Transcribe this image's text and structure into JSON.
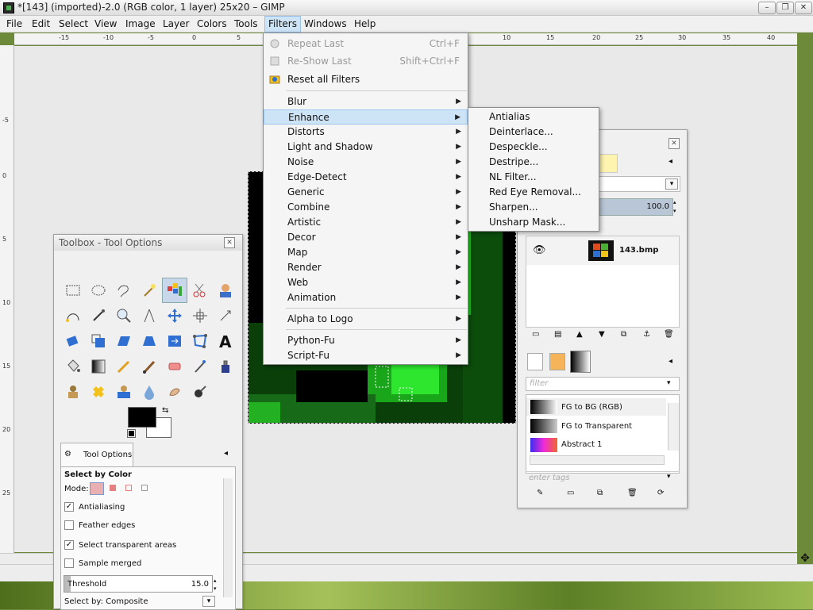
{
  "window": {
    "title": "*[143] (imported)-2.0 (RGB color, 1 layer) 25x20 – GIMP",
    "controls": [
      "–",
      "❐",
      "✕"
    ]
  },
  "menubar": [
    "File",
    "Edit",
    "Select",
    "View",
    "Image",
    "Layer",
    "Colors",
    "Tools",
    "Filters",
    "Windows",
    "Help"
  ],
  "ruler": {
    "h_labels": [
      "-15",
      "-10",
      "-5",
      "0",
      "5",
      "10",
      "15",
      "20",
      "25",
      "30",
      "35",
      "40"
    ],
    "v_labels": [
      "-5",
      "0",
      "5",
      "10",
      "15",
      "20",
      "25"
    ]
  },
  "filters_menu": {
    "top": [
      {
        "label": "Repeat Last",
        "accel": "Ctrl+F",
        "disabled": true,
        "icon": "repeat-icon"
      },
      {
        "label": "Re-Show Last",
        "accel": "Shift+Ctrl+F",
        "disabled": true,
        "icon": "reshow-icon"
      },
      {
        "label": "Reset all Filters",
        "accel": "",
        "disabled": false,
        "icon": "reset-icon"
      }
    ],
    "groups": [
      "Blur",
      "Enhance",
      "Distorts",
      "Light and Shadow",
      "Noise",
      "Edge-Detect",
      "Generic",
      "Combine",
      "Artistic",
      "Decor",
      "Map",
      "Render",
      "Web",
      "Animation"
    ],
    "alpha": "Alpha to Logo",
    "scripting": [
      "Python-Fu",
      "Script-Fu"
    ]
  },
  "enhance_menu": [
    "Antialias",
    "Deinterlace...",
    "Despeckle...",
    "Destripe...",
    "NL Filter...",
    "Red Eye Removal...",
    "Sharpen...",
    "Unsharp Mask..."
  ],
  "toolbox": {
    "title": "Toolbox - Tool Options",
    "tab": "Tool Options",
    "section": "Select by Color",
    "mode_label": "Mode:",
    "options": [
      {
        "label": "Antialiasing",
        "checked": true
      },
      {
        "label": "Feather edges",
        "checked": false
      },
      {
        "label": "Select transparent areas",
        "checked": true
      },
      {
        "label": "Sample merged",
        "checked": false
      }
    ],
    "threshold_label": "Threshold",
    "threshold_value": "15.0",
    "select_by_label": "Select by",
    "select_by_value": "Composite"
  },
  "layers": {
    "opacity": "100.0",
    "layer_name": "143.bmp",
    "gradients": [
      {
        "name": "FG to BG (RGB)"
      },
      {
        "name": "FG to Transparent"
      },
      {
        "name": "Abstract 1"
      }
    ],
    "filter_placeholder": "filter",
    "tags_placeholder": "enter tags"
  }
}
